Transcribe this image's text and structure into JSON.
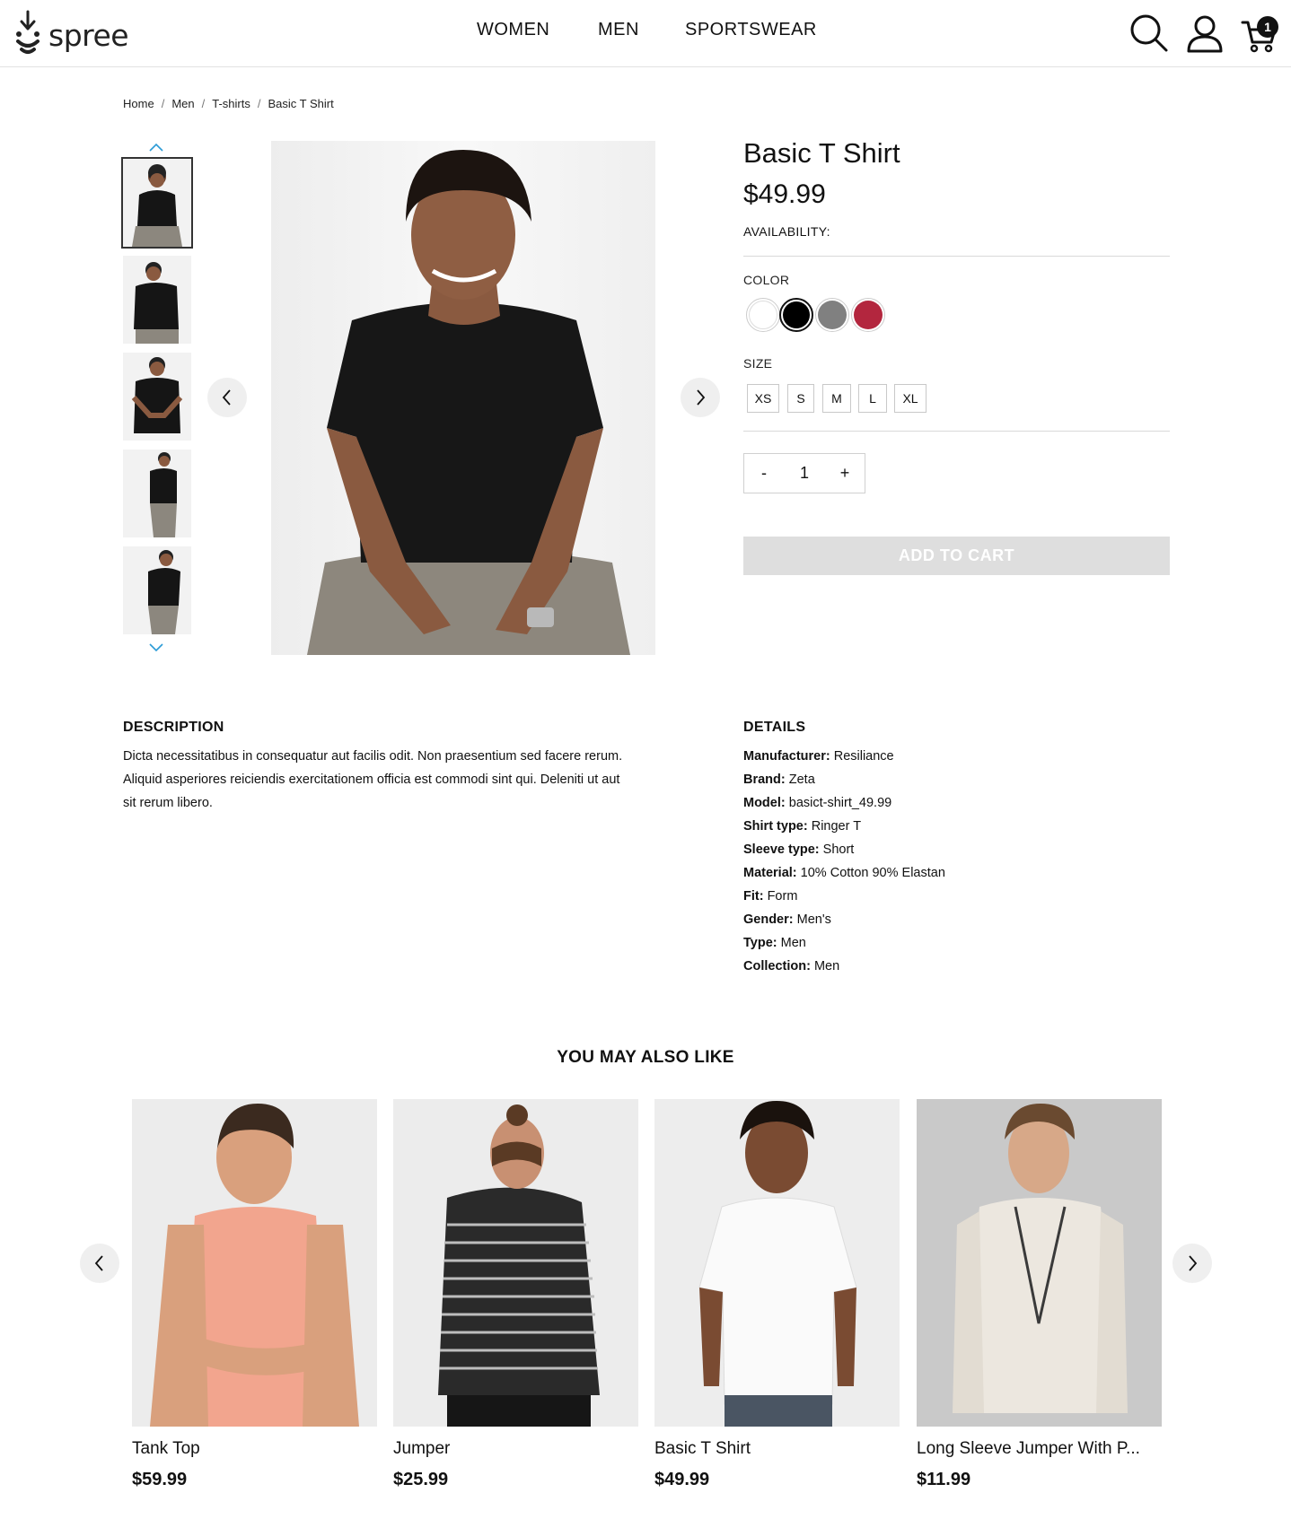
{
  "header": {
    "logo_text": "spree",
    "nav": [
      "WOMEN",
      "MEN",
      "SPORTSWEAR"
    ],
    "cart_count": "1"
  },
  "breadcrumb": [
    "Home",
    "Men",
    "T-shirts",
    "Basic T Shirt"
  ],
  "product": {
    "title": "Basic T Shirt",
    "price": "$49.99",
    "availability_label": "AVAILABILITY:",
    "color_label": "COLOR",
    "colors": [
      "#ffffff",
      "#000000",
      "#808080",
      "#b3263e"
    ],
    "size_label": "SIZE",
    "sizes": [
      "XS",
      "S",
      "M",
      "L",
      "XL"
    ],
    "qty_minus": "-",
    "quantity": "1",
    "qty_plus": "+",
    "add_to_cart": "ADD TO CART"
  },
  "description": {
    "heading": "DESCRIPTION",
    "text": "Dicta necessitatibus in consequatur aut facilis odit. Non praesentium sed facere rerum. Aliquid asperiores reiciendis exercitationem officia est commodi sint qui. Deleniti ut aut sit rerum libero."
  },
  "details": {
    "heading": "DETAILS",
    "rows": [
      {
        "label": "Manufacturer:",
        "value": "Resiliance"
      },
      {
        "label": "Brand:",
        "value": "Zeta"
      },
      {
        "label": "Model:",
        "value": "basict-shirt_49.99"
      },
      {
        "label": "Shirt type:",
        "value": "Ringer T"
      },
      {
        "label": "Sleeve type:",
        "value": "Short"
      },
      {
        "label": "Material:",
        "value": "10% Cotton 90% Elastan"
      },
      {
        "label": "Fit:",
        "value": "Form"
      },
      {
        "label": "Gender:",
        "value": "Men's"
      },
      {
        "label": "Type:",
        "value": "Men"
      },
      {
        "label": "Collection:",
        "value": "Men"
      }
    ]
  },
  "related": {
    "heading": "YOU MAY ALSO LIKE",
    "items": [
      {
        "name": "Tank Top",
        "price": "$59.99"
      },
      {
        "name": "Jumper",
        "price": "$25.99"
      },
      {
        "name": "Basic T Shirt",
        "price": "$49.99"
      },
      {
        "name": "Long Sleeve Jumper With P...",
        "price": "$11.99"
      }
    ]
  }
}
